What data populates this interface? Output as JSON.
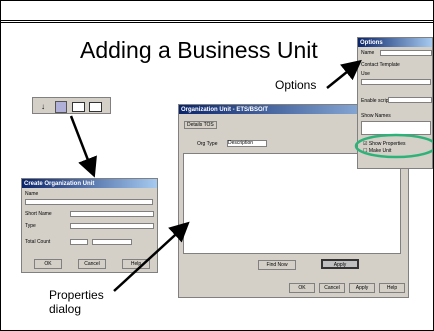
{
  "slide": {
    "title": "Adding a Business Unit",
    "callouts": {
      "options": "Options",
      "properties_line1": "Properties",
      "properties_line2": "dialog"
    }
  },
  "toolbar_strip": {
    "icons": [
      "cursor-icon",
      "new-unit-icon",
      "window-icon",
      "window-icon"
    ]
  },
  "new_unit_dialog": {
    "title": "Create Organization Unit",
    "labels": [
      "Name",
      "Short Name",
      "Type",
      "Total Count"
    ],
    "buttons": [
      "OK",
      "Cancel",
      "Help"
    ]
  },
  "properties_dialog": {
    "title": "Organization Unit - ETS/BSO/T",
    "tab": "Details TOS",
    "field_label": "Org Type",
    "field_value": "Description",
    "buttons": [
      "Find Now",
      "Apply",
      "OK",
      "Cancel",
      "Apply",
      "Help"
    ]
  },
  "options_dialog": {
    "title": "Options",
    "labels": [
      "Name",
      "Contact Template",
      "Use",
      "Enable scripts",
      "Show Names"
    ],
    "checkboxes": [
      "Show Properties",
      "Make Unit"
    ]
  },
  "colors": {
    "titlebar_start": "#0a246a",
    "titlebar_end": "#a6caf0",
    "highlight_ellipse": "#2db37a",
    "dialog_face": "#d4d0c8"
  }
}
